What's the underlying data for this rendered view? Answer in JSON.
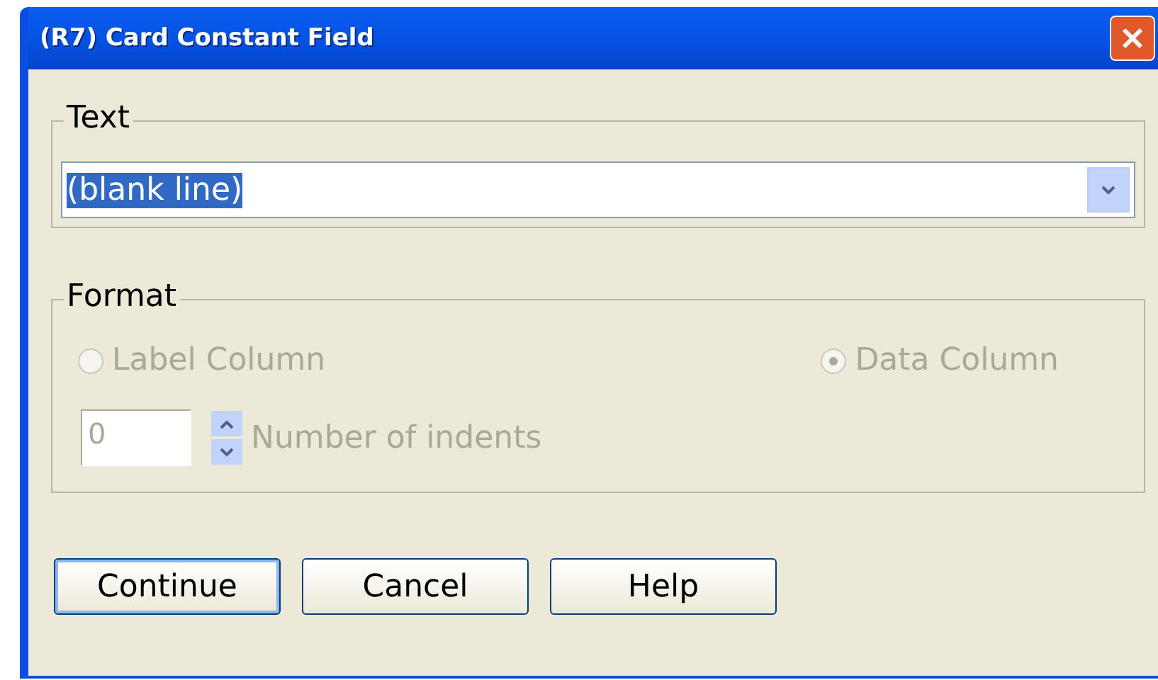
{
  "window": {
    "title": "(R7) Card Constant Field"
  },
  "text_group": {
    "label": "Text",
    "value": "(blank line)",
    "highlighted": true
  },
  "format_group": {
    "label": "Format",
    "disabled": true,
    "options": [
      {
        "label": "Label Column",
        "selected": false
      },
      {
        "label": "Data Column",
        "selected": true
      }
    ],
    "indents": {
      "value": "0",
      "label": "Number of indents"
    }
  },
  "buttons": [
    {
      "label": "Continue",
      "default": true
    },
    {
      "label": "Cancel",
      "default": false
    },
    {
      "label": "Help",
      "default": false
    }
  ]
}
